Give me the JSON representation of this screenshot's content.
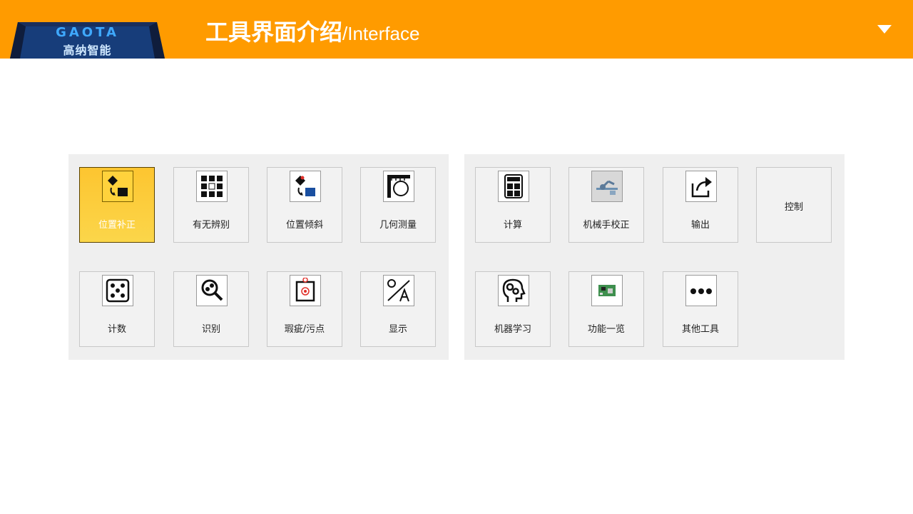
{
  "header": {
    "logo_en": "GAOTA",
    "logo_cn": "高纳智能",
    "title_cn": "工具界面介绍",
    "title_en": "/Interface",
    "accent_color": "#ff9b00"
  },
  "left_panel": {
    "tools": [
      {
        "label": "位置补正",
        "icon": "position-compensation-icon",
        "active": true
      },
      {
        "label": "有无辨别",
        "icon": "grid-dots-icon"
      },
      {
        "label": "位置倾斜",
        "icon": "position-tilt-icon"
      },
      {
        "label": "几何测量",
        "icon": "ruler-circle-icon"
      },
      {
        "label": "计数",
        "icon": "dice-icon"
      },
      {
        "label": "识别",
        "icon": "magnifier-icon"
      },
      {
        "label": "瑕疵/污点",
        "icon": "defect-target-icon"
      },
      {
        "label": "显示",
        "icon": "percent-text-icon"
      }
    ]
  },
  "right_panel": {
    "tools": [
      {
        "label": "计算",
        "icon": "calculator-icon"
      },
      {
        "label": "机械手校正",
        "icon": "robot-arm-icon"
      },
      {
        "label": "输出",
        "icon": "share-export-icon"
      },
      {
        "label": "控制",
        "icon": ""
      },
      {
        "label": "机器学习",
        "icon": "head-gears-icon"
      },
      {
        "label": "功能一览",
        "icon": "circuit-board-icon"
      },
      {
        "label": "其他工具",
        "icon": "more-dots-icon"
      }
    ]
  }
}
